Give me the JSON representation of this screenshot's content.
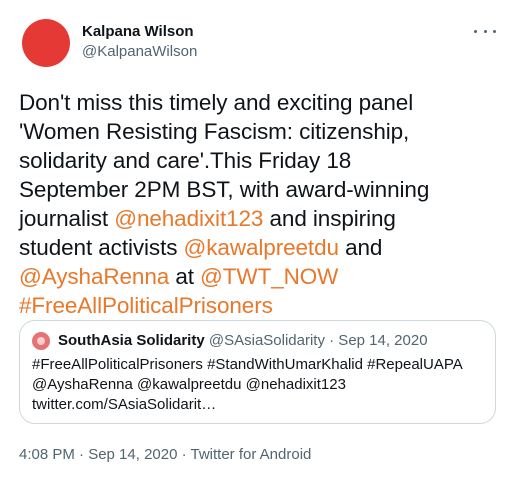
{
  "author": {
    "name": "Kalpana Wilson",
    "handle": "@KalpanaWilson",
    "avatar_color": "#e53935"
  },
  "more_icon": "more-horizontal-icon",
  "tweet": {
    "lines": [
      [
        {
          "text": "Don't miss this timely and exciting panel",
          "link": false
        }
      ],
      [
        {
          "text": "'Women Resisting Fascism: citizenship,",
          "link": false
        }
      ],
      [
        {
          "text": "solidarity and care'.This Friday 18",
          "link": false
        }
      ],
      [
        {
          "text": "September 2PM BST, with award-winning",
          "link": false
        }
      ],
      [
        {
          "text": "journalist ",
          "link": false
        },
        {
          "text": "@nehadixit123",
          "link": true
        },
        {
          "text": " and inspiring",
          "link": false
        }
      ],
      [
        {
          "text": "student activists ",
          "link": false
        },
        {
          "text": "@kawalpreetdu",
          "link": true
        },
        {
          "text": " and",
          "link": false
        }
      ],
      [
        {
          "text": "@AyshaRenna",
          "link": true
        },
        {
          "text": " at ",
          "link": false
        },
        {
          "text": "@TWT_NOW",
          "link": true
        }
      ],
      [
        {
          "text": "#FreeAllPoliticalPrisoners",
          "link": true
        }
      ]
    ],
    "link_color": "#e8782a"
  },
  "quote": {
    "name": "SouthAsia Solidarity",
    "meta": "@SAsiaSolidarity · Sep 14, 2020",
    "lines": [
      "#FreeAllPoliticalPrisoners #StandWithUmarKhalid #RepealUAPA",
      "@AyshaRenna @kawalpreetdu @nehadixit123",
      "twitter.com/SAsiaSolidarit…"
    ]
  },
  "footer": {
    "text": "4:08 PM · Sep 14, 2020 · Twitter for Android"
  }
}
